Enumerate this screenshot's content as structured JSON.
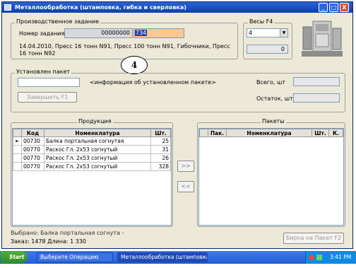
{
  "window": {
    "title": "Металлообработка (штамповка, гибка и сверловка)",
    "minimize": "_",
    "maximize": "□",
    "close": "X"
  },
  "production": {
    "group_label": "Производственное задание",
    "task_label": "Номер задания",
    "task_number": "00000000",
    "task_input": "734",
    "description": "14.04.2010, Пресс 16 тонн N91, Пресс 100 тонн N91, Гибочники, Пресс 16 тонн N92"
  },
  "scales": {
    "group_label": "Весы  F4",
    "select_value": "4",
    "weight_value": "0"
  },
  "callout": "4",
  "package": {
    "group_label": "Установлен пакет",
    "info": "<информация об установленном пакете>",
    "finish_button": "Завершить     F1",
    "total_label": "Всего, шт",
    "remaining_label": "Остаток, шт"
  },
  "products": {
    "group_label": "Продукция",
    "columns": [
      "Код",
      "Номенклатура",
      "Шт."
    ],
    "rows": [
      {
        "code": "00730",
        "name": "Балка портальная согнутая",
        "qty": "25"
      },
      {
        "code": "00770",
        "name": "Раскос Гл. 2х53 согнутый",
        "qty": "31"
      },
      {
        "code": "00770",
        "name": "Раскос Гл. 2х53 согнутый",
        "qty": "26"
      },
      {
        "code": "00770",
        "name": "Раскос Гл. 2х53 согнутый",
        "qty": "328"
      }
    ]
  },
  "packages": {
    "group_label": "Пакеты",
    "columns": [
      "Пак.",
      "Номенклатура",
      "Шт.",
      "К."
    ]
  },
  "arrows": {
    "forward": ">>",
    "back": "<<"
  },
  "footer": {
    "selected": "Выбрано: Балка портальная согнута -",
    "order": "Заказ: 1478  Длина: 1 330",
    "tag_button": "Бирка на Пакет   F2"
  },
  "taskbar": {
    "start": "Start",
    "task1": "Выберите Операцию",
    "task2": "Металлообработка (штамповка,...",
    "clock": "3:41 PM"
  }
}
